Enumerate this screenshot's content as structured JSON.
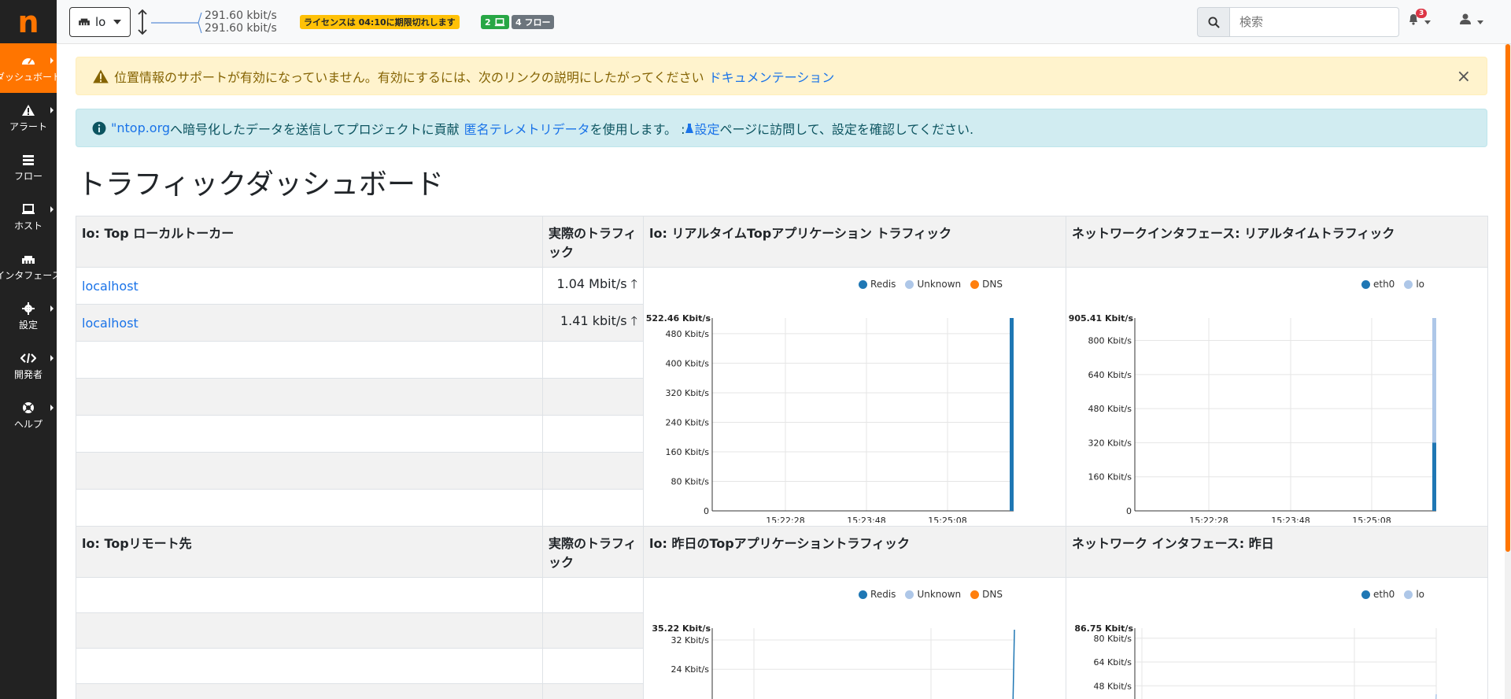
{
  "sidebar": {
    "logo": "n",
    "items": [
      {
        "label": "ダッシュボード",
        "icon": "gauge-icon",
        "active": true
      },
      {
        "label": "アラート",
        "icon": "warning-icon"
      },
      {
        "label": "フロー",
        "icon": "stream-icon"
      },
      {
        "label": "ホスト",
        "icon": "laptop-icon"
      },
      {
        "label": "インタフェース",
        "icon": "ethernet-icon"
      },
      {
        "label": "設定",
        "icon": "cog-icon"
      },
      {
        "label": "開発者",
        "icon": "code-icon"
      },
      {
        "label": "ヘルプ",
        "icon": "lifering-icon"
      }
    ]
  },
  "topbar": {
    "interface": "lo",
    "rate_up": "291.60 kbit/s",
    "rate_down": "291.60 kbit/s",
    "license": "ライセンスは 04:10に期限切れします",
    "hosts_count": "2",
    "flows": "4 フロー",
    "search_placeholder": "検索",
    "alerts_count": "3"
  },
  "alerts": {
    "geo_text": "位置情報のサポートが有効になっていません。有効にするには、次のリンクの説明にしたがってください",
    "geo_link": "ドキュメンテーション",
    "close": "×",
    "telemetry_link1": "\"ntop.org",
    "telemetry_text1": "へ暗号化したデータを送信してプロジェクトに貢献",
    "telemetry_link2": "匿名テレメトリデータ",
    "telemetry_text2": "を使用します。 : ",
    "telemetry_link3": "設定",
    "telemetry_text3": " ページに訪問して、設定を確認してください."
  },
  "page_title": "トラフィックダッシュボード",
  "panels": {
    "top_local": "lo: Top ローカルトーカー",
    "actual_traffic": "実際のトラフィック",
    "realtime_apps": "lo: リアルタイムTopアプリケーション トラフィック",
    "iface_realtime": "ネットワークインタフェース: リアルタイムトラフィック",
    "top_remote": "lo: Topリモート先",
    "actual_traffic2": "実際のトラフィック",
    "yesterday_apps": "lo: 昨日のTopアプリケーショントラフィック",
    "iface_yesterday": "ネットワーク インタフェース: 昨日"
  },
  "local_talkers": [
    {
      "host": "localhost",
      "traffic": "1.04 Mbit/s"
    },
    {
      "host": "localhost",
      "traffic": "1.41 kbit/s"
    }
  ],
  "colors": {
    "redis": "#1f77b4",
    "unknown": "#aec7e8",
    "dns": "#ff7f0e",
    "eth0": "#1f77b4",
    "lo": "#aec7e8",
    "accent": "#ff7500"
  },
  "chart_data": [
    {
      "type": "area",
      "title": "lo: リアルタイムTopアプリケーション トラフィック",
      "max_label": "522.46 Kbit/s",
      "series": [
        {
          "name": "Redis"
        },
        {
          "name": "Unknown"
        },
        {
          "name": "DNS"
        }
      ],
      "y_ticks": [
        "480 Kbit/s",
        "400 Kbit/s",
        "320 Kbit/s",
        "240 Kbit/s",
        "160 Kbit/s",
        "80 Kbit/s",
        "0"
      ],
      "x_ticks": [
        "15:22:28",
        "15:23:48",
        "15:25:08"
      ],
      "ylim": [
        0,
        522.46
      ],
      "last_value": {
        "Redis": 522.46
      }
    },
    {
      "type": "area",
      "title": "ネットワークインタフェース: リアルタイムトラフィック",
      "max_label": "905.41 Kbit/s",
      "series": [
        {
          "name": "eth0"
        },
        {
          "name": "lo"
        }
      ],
      "y_ticks": [
        "800 Kbit/s",
        "640 Kbit/s",
        "480 Kbit/s",
        "320 Kbit/s",
        "160 Kbit/s",
        "0"
      ],
      "x_ticks": [
        "15:22:28",
        "15:23:48",
        "15:25:08"
      ],
      "ylim": [
        0,
        905.41
      ],
      "last_value": {
        "eth0": 320,
        "lo": 905.41
      }
    },
    {
      "type": "area",
      "title": "lo: 昨日のTopアプリケーショントラフィック",
      "max_label": "35.22 Kbit/s",
      "series": [
        {
          "name": "Redis"
        },
        {
          "name": "Unknown"
        },
        {
          "name": "DNS"
        }
      ],
      "y_ticks": [
        "32 Kbit/s",
        "24 Kbit/s"
      ],
      "ylim": [
        0,
        35.22
      ]
    },
    {
      "type": "area",
      "title": "ネットワーク インタフェース: 昨日",
      "max_label": "86.75 Kbit/s",
      "series": [
        {
          "name": "eth0"
        },
        {
          "name": "lo"
        }
      ],
      "y_ticks": [
        "80 Kbit/s",
        "64 Kbit/s",
        "48 Kbit/s"
      ],
      "ylim": [
        0,
        86.75
      ]
    }
  ]
}
